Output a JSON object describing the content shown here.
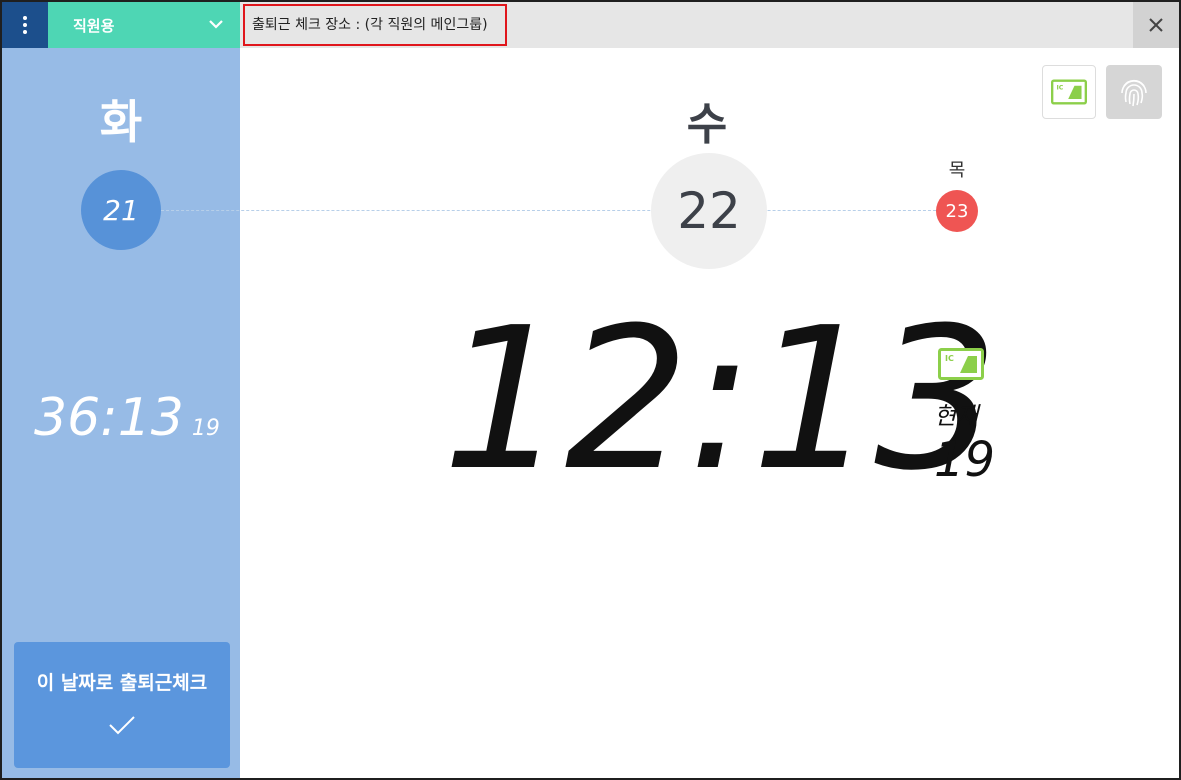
{
  "header": {
    "role_label": "직원용",
    "location_text": "출퇴근 체크 장소 : (각 직원의 메인그룹)"
  },
  "prev": {
    "day": "화",
    "date": "21"
  },
  "current": {
    "day": "수",
    "date": "22"
  },
  "next": {
    "day": "목",
    "date": "23"
  },
  "elapsed": {
    "time": "36:13",
    "seconds": "19"
  },
  "clock": {
    "time": "12:13",
    "now_label": "현재",
    "seconds": "19"
  },
  "checkin_button": {
    "label": "이 날짜로 출퇴근체크"
  },
  "icons": {
    "menu": "kebab-menu-icon",
    "dropdown": "chevron-down-icon",
    "close": "close-icon",
    "ic_card": "ic-card-icon",
    "fingerprint": "fingerprint-icon",
    "check": "checkmark-icon"
  },
  "colors": {
    "menu_bg": "#1c4f8c",
    "role_bg": "#4ed6b4",
    "left_panel_bg": "#97bbe6",
    "prev_date_bg": "#5792d8",
    "next_date_bg": "#ef5553",
    "location_border": "#e0161c",
    "ic_green": "#8ccf4a"
  }
}
